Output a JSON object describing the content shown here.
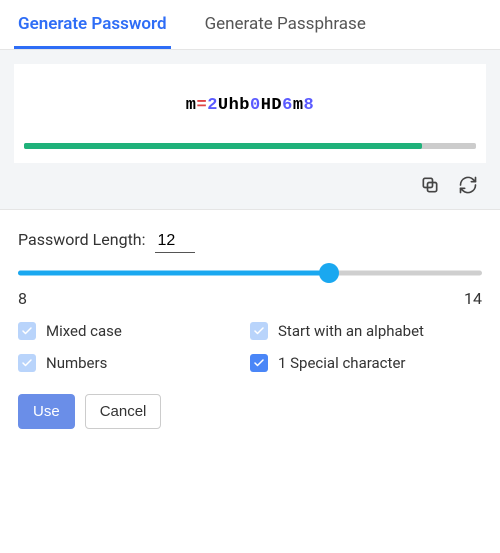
{
  "tabs": {
    "password": "Generate Password",
    "passphrase": "Generate Passphrase"
  },
  "password": {
    "chars": [
      {
        "ch": "m",
        "cls": "c-lower"
      },
      {
        "ch": "=",
        "cls": "c-special"
      },
      {
        "ch": "2",
        "cls": "c-digit"
      },
      {
        "ch": "U",
        "cls": "c-upper"
      },
      {
        "ch": "h",
        "cls": "c-lower"
      },
      {
        "ch": "b",
        "cls": "c-lower"
      },
      {
        "ch": "0",
        "cls": "c-digit"
      },
      {
        "ch": "H",
        "cls": "c-upper"
      },
      {
        "ch": "D",
        "cls": "c-upper"
      },
      {
        "ch": "6",
        "cls": "c-digit"
      },
      {
        "ch": "m",
        "cls": "c-lower"
      },
      {
        "ch": "8",
        "cls": "c-digit"
      }
    ],
    "strength_percent": 88
  },
  "length": {
    "label": "Password Length:",
    "value": "12",
    "min": "8",
    "max": "14",
    "slider_percent": 67
  },
  "options": {
    "mixed_case": {
      "label": "Mixed case",
      "checked": true
    },
    "start_alpha": {
      "label": "Start with an alphabet",
      "checked": true
    },
    "numbers": {
      "label": "Numbers",
      "checked": true
    },
    "special": {
      "label": "1 Special character",
      "checked": true
    }
  },
  "buttons": {
    "use": "Use",
    "cancel": "Cancel"
  },
  "icons": {
    "copy": "copy-icon",
    "refresh": "refresh-icon"
  }
}
